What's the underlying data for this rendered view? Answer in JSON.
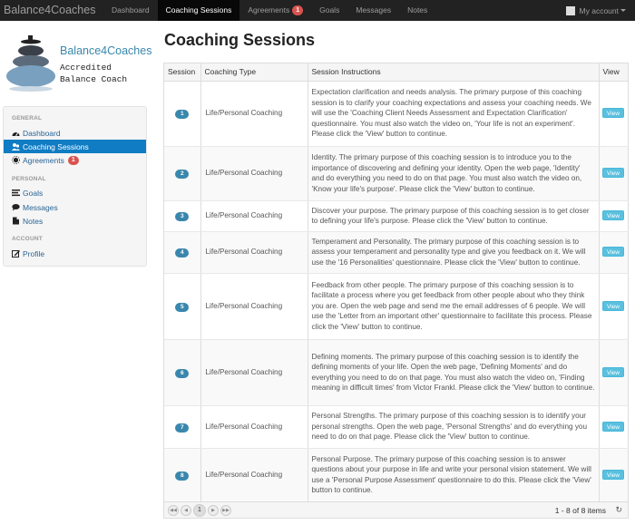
{
  "navbar": {
    "brand": "Balance4Coaches",
    "items": [
      {
        "label": "Dashboard"
      },
      {
        "label": "Coaching Sessions"
      },
      {
        "label": "Agreements",
        "badge": "1"
      },
      {
        "label": "Goals"
      },
      {
        "label": "Messages"
      },
      {
        "label": "Notes"
      }
    ],
    "account": "My account"
  },
  "logo": {
    "title": "Balance4Coaches",
    "subtitle_line1": "Accredited",
    "subtitle_line2": "Balance Coach"
  },
  "sidebar": {
    "general_header": "GENERAL",
    "dashboard": "Dashboard",
    "coaching_sessions": "Coaching Sessions",
    "agreements": "Agreements",
    "agreements_badge": "1",
    "personal_header": "PERSONAL",
    "goals": "Goals",
    "messages": "Messages",
    "notes": "Notes",
    "account_header": "ACCOUNT",
    "profile": "Profile"
  },
  "main": {
    "title": "Coaching Sessions",
    "columns": {
      "session": "Session",
      "type": "Coaching Type",
      "instructions": "Session Instructions",
      "view": "View"
    },
    "view_label": "View",
    "rows": [
      {
        "session": "1",
        "type": "Life/Personal Coaching",
        "instructions": "Expectation clarification and needs analysis. The primary purpose of this coaching session is to clarify your coaching expectations and assess your coaching needs. We will use the 'Coaching Client Needs Assessment and Expectation Clarification' questionnaire. You must also watch the video on, 'Your life is not an experiment'. Please click the 'View' button to continue."
      },
      {
        "session": "2",
        "type": "Life/Personal Coaching",
        "instructions": "Identity. The primary purpose of this coaching session is to introduce you to the importance of discovering and defining your identity. Open the web page, 'Identity' and do everything you need to do on that page. You must also watch the video on, 'Know your life's purpose'. Please click the 'View' button to continue."
      },
      {
        "session": "3",
        "type": "Life/Personal Coaching",
        "instructions": "Discover your purpose. The primary purpose of this coaching session is to get closer to defining your life's purpose. Please click the 'View' button to continue."
      },
      {
        "session": "4",
        "type": "Life/Personal Coaching",
        "instructions": "Temperament and Personality. The primary purpose of this coaching session is to assess your temperament and personality type and give you feedback on it. We will use the '16 Personalities' questionnaire. Please click the 'View' button to continue."
      },
      {
        "session": "5",
        "type": "Life/Personal Coaching",
        "instructions": "Feedback from other people. The primary purpose of this coaching session is to facilitate a process where you get feedback from other people about who they think you are. Open the web page and send me the email addresses of 6 people. We will use the 'Letter from an important other' questionnaire to facilitate this process. Please click the 'View' button to continue."
      },
      {
        "session": "6",
        "type": "Life/Personal Coaching",
        "instructions": "Defining moments. The primary purpose of this coaching session is to identify the defining moments of your life. Open the web page, 'Defining Moments' and do everything you need to do on that page. You must also watch the video on, 'Finding meaning in difficult times' from Victor Frankl. Please click the 'View' button to continue."
      },
      {
        "session": "7",
        "type": "Life/Personal Coaching",
        "instructions": "Personal Strengths. The primary purpose of this coaching session is to identify your personal strengths. Open the web page, 'Personal Strengths' and do everything you need to do on that page. Please click the 'View' button to continue."
      },
      {
        "session": "8",
        "type": "Life/Personal Coaching",
        "instructions": "Personal Purpose. The primary purpose of this coaching session is to answer questions about your purpose in life and write your personal vision statement. We will use a 'Personal Purpose Assessment' questionnaire to do this. Please click the 'View' button to continue."
      }
    ],
    "pager": {
      "current_page": "1",
      "info": "1 - 8 of 8 items"
    }
  }
}
